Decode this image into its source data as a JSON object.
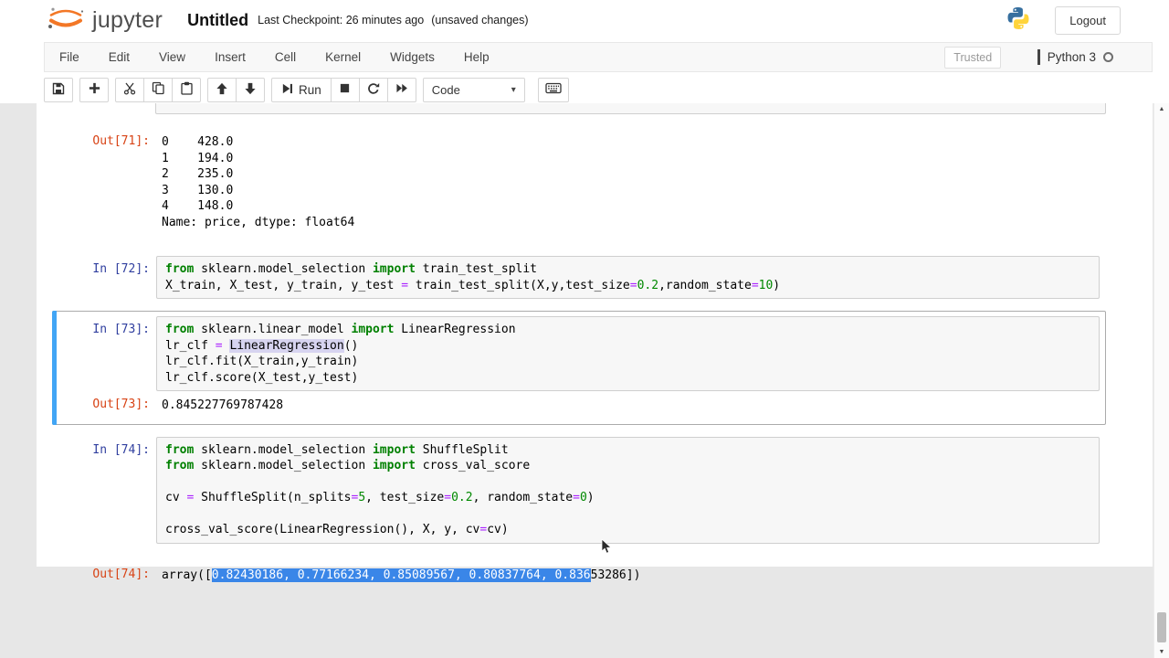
{
  "header": {
    "brand": "jupyter",
    "title": "Untitled",
    "checkpoint": "Last Checkpoint: 26 minutes ago",
    "unsaved": "(unsaved changes)",
    "logout_label": "Logout"
  },
  "menubar": {
    "items": [
      "File",
      "Edit",
      "View",
      "Insert",
      "Cell",
      "Kernel",
      "Widgets",
      "Help"
    ],
    "trusted_label": "Trusted",
    "kernel_name": "Python 3"
  },
  "toolbar": {
    "run_label": "Run",
    "cell_type": "Code",
    "icons": [
      "save-icon",
      "add-cell-icon",
      "cut-icon",
      "copy-icon",
      "paste-icon",
      "move-up-icon",
      "move-down-icon",
      "run-icon",
      "stop-icon",
      "restart-kernel-icon",
      "restart-run-all-icon",
      "dropdown-caret-icon",
      "command-palette-icon"
    ]
  },
  "colors": {
    "selected_cell_accent": "#42a5f5",
    "selection_blue": "#3a86e8",
    "in_prompt": "#303f9f",
    "out_prompt": "#d84315",
    "keyword": "#008000",
    "number": "#008800",
    "operator": "#aa22ff",
    "word_highlight": "#d7d4f0",
    "jupyter_orange": "#f37726"
  },
  "notebook": {
    "cells": [
      {
        "kind": "partial-input"
      },
      {
        "kind": "output",
        "prompt": "Out[71]:",
        "lines": [
          [
            {
              "t": "0    428.0",
              "c": "p"
            }
          ],
          [
            {
              "t": "1    194.0",
              "c": "p"
            }
          ],
          [
            {
              "t": "2    235.0",
              "c": "p"
            }
          ],
          [
            {
              "t": "3    130.0",
              "c": "p"
            }
          ],
          [
            {
              "t": "4    148.0",
              "c": "p"
            }
          ],
          [
            {
              "t": "Name: price, dtype: float64",
              "c": "p"
            }
          ]
        ]
      },
      {
        "kind": "code",
        "prompt": "In [72]:",
        "selected": false,
        "lines": [
          [
            {
              "t": "from",
              "c": "k"
            },
            {
              "t": " sklearn.model_selection ",
              "c": "p"
            },
            {
              "t": "import",
              "c": "k"
            },
            {
              "t": " train_test_split",
              "c": "p"
            }
          ],
          [
            {
              "t": "X_train, X_test, y_train, y_test ",
              "c": "p"
            },
            {
              "t": "=",
              "c": "o"
            },
            {
              "t": " train_test_split(X,y,test_size",
              "c": "p"
            },
            {
              "t": "=",
              "c": "o"
            },
            {
              "t": "0.2",
              "c": "n"
            },
            {
              "t": ",random_state",
              "c": "p"
            },
            {
              "t": "=",
              "c": "o"
            },
            {
              "t": "10",
              "c": "n"
            },
            {
              "t": ")",
              "c": "p"
            }
          ]
        ]
      },
      {
        "kind": "code",
        "prompt": "In [73]:",
        "selected": true,
        "lines": [
          [
            {
              "t": "from",
              "c": "k"
            },
            {
              "t": " sklearn.linear_model ",
              "c": "p"
            },
            {
              "t": "import",
              "c": "k"
            },
            {
              "t": " LinearRegression",
              "c": "p"
            }
          ],
          [
            {
              "t": "lr_clf ",
              "c": "p"
            },
            {
              "t": "=",
              "c": "o"
            },
            {
              "t": " ",
              "c": "p"
            },
            {
              "t": "LinearRegression",
              "c": "hl"
            },
            {
              "t": "()",
              "c": "p"
            }
          ],
          [
            {
              "t": "lr_clf.fit(X_train,y_train)",
              "c": "p"
            }
          ],
          [
            {
              "t": "lr_clf.score(X_test,y_test)",
              "c": "p"
            }
          ]
        ],
        "output": {
          "prompt": "Out[73]:",
          "lines": [
            [
              {
                "t": "0.845227769787428",
                "c": "p"
              }
            ]
          ]
        }
      },
      {
        "kind": "code",
        "prompt": "In [74]:",
        "selected": false,
        "lines": [
          [
            {
              "t": "from",
              "c": "k"
            },
            {
              "t": " sklearn.model_selection ",
              "c": "p"
            },
            {
              "t": "import",
              "c": "k"
            },
            {
              "t": " ShuffleSplit",
              "c": "p"
            }
          ],
          [
            {
              "t": "from",
              "c": "k"
            },
            {
              "t": " sklearn.model_selection ",
              "c": "p"
            },
            {
              "t": "import",
              "c": "k"
            },
            {
              "t": " cross_val_score",
              "c": "p"
            }
          ],
          [
            {
              "t": "",
              "c": "p"
            }
          ],
          [
            {
              "t": "cv ",
              "c": "p"
            },
            {
              "t": "=",
              "c": "o"
            },
            {
              "t": " ShuffleSplit(n_splits",
              "c": "p"
            },
            {
              "t": "=",
              "c": "o"
            },
            {
              "t": "5",
              "c": "n"
            },
            {
              "t": ", test_size",
              "c": "p"
            },
            {
              "t": "=",
              "c": "o"
            },
            {
              "t": "0.2",
              "c": "n"
            },
            {
              "t": ", random_state",
              "c": "p"
            },
            {
              "t": "=",
              "c": "o"
            },
            {
              "t": "0",
              "c": "n"
            },
            {
              "t": ")",
              "c": "p"
            }
          ],
          [
            {
              "t": "",
              "c": "p"
            }
          ],
          [
            {
              "t": "cross_val_score(LinearRegression(), X, y, cv",
              "c": "p"
            },
            {
              "t": "=",
              "c": "o"
            },
            {
              "t": "cv)",
              "c": "p"
            }
          ]
        ]
      },
      {
        "kind": "output",
        "prompt": "Out[74]:",
        "lines": [
          [
            {
              "t": "array([",
              "c": "p"
            },
            {
              "t": "0.82430186, 0.77166234, 0.85089567, 0.80837764, 0.836",
              "c": "sel"
            },
            {
              "t": "53286])",
              "c": "p"
            }
          ]
        ]
      }
    ]
  }
}
